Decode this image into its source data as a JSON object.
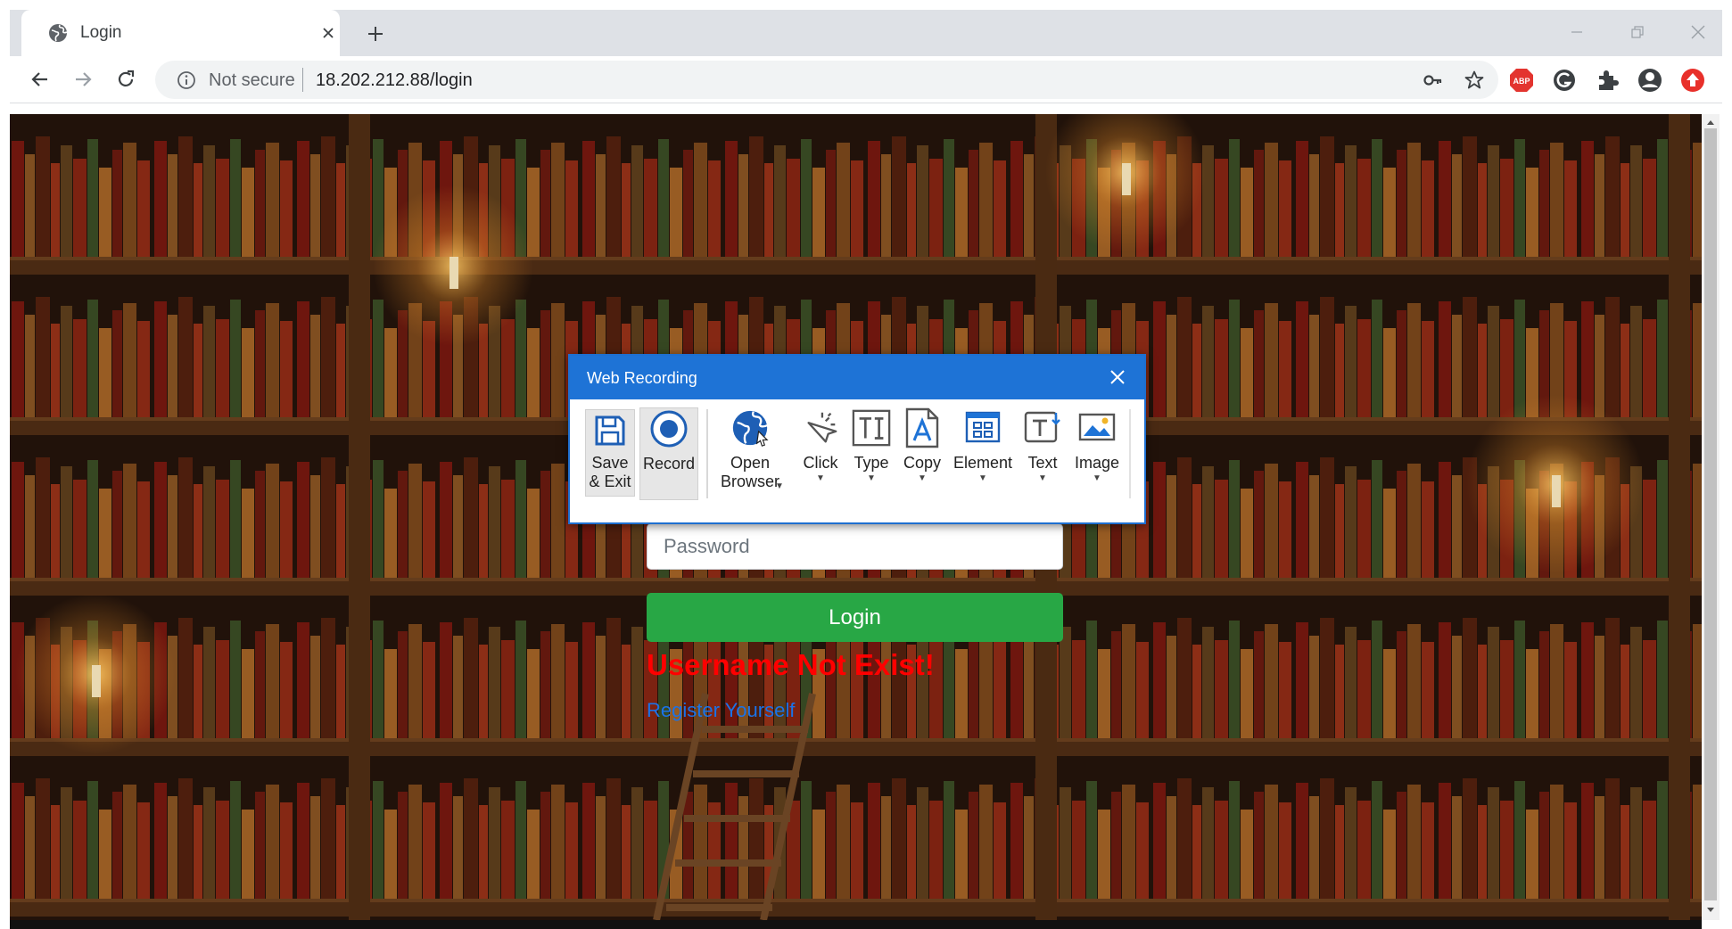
{
  "browser": {
    "tab_title": "Login",
    "security_label": "Not secure",
    "url": "18.202.212.88/login",
    "new_tab_symbol": "+",
    "icons": [
      "globe-icon",
      "close-icon",
      "back-icon",
      "forward-icon",
      "reload-icon",
      "info-icon",
      "key-icon",
      "star-icon",
      "adblock-icon",
      "grammarly-icon",
      "puzzle-icon",
      "profile-icon",
      "update-icon"
    ],
    "adblock_label": "ABP"
  },
  "page": {
    "password_placeholder": "Password",
    "login_label": "Login",
    "error_message": "Username Not Exist!",
    "register_link": "Register Yourself",
    "colors": {
      "login_button": "#28a745",
      "error": "#ff0000",
      "link": "#1a73e8"
    }
  },
  "recorder": {
    "title": "Web Recording",
    "tools": [
      {
        "label": "Save\n& Exit",
        "icon": "floppy-disk-icon"
      },
      {
        "label": "Record",
        "icon": "record-icon"
      },
      {
        "label": "Open\nBrowser",
        "icon": "globe-icon",
        "dropdown": true
      },
      {
        "label": "Click",
        "icon": "cursor-click-icon",
        "dropdown": true
      },
      {
        "label": "Type",
        "icon": "type-icon",
        "dropdown": true
      },
      {
        "label": "Copy",
        "icon": "copy-icon",
        "dropdown": true
      },
      {
        "label": "Element",
        "icon": "element-icon",
        "dropdown": true
      },
      {
        "label": "Text",
        "icon": "text-icon",
        "dropdown": true
      },
      {
        "label": "Image",
        "icon": "image-icon",
        "dropdown": true
      }
    ],
    "accent_color": "#1e73d6"
  }
}
